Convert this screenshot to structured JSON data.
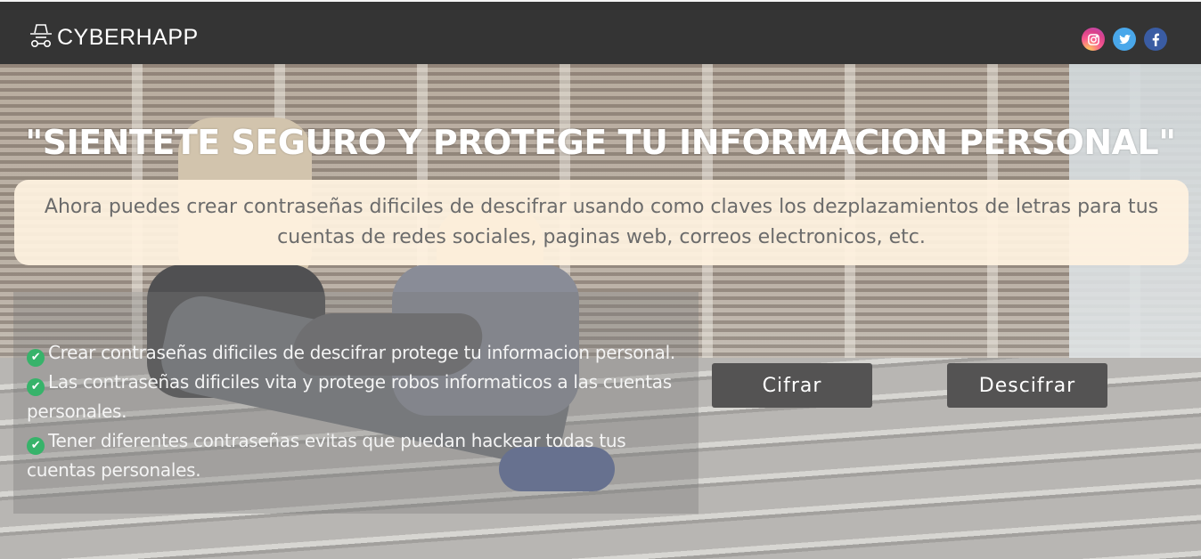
{
  "navbar": {
    "brand": "CYBERHAPP",
    "brand_icon": "hacker-incognito-icon",
    "social": [
      {
        "name": "instagram-icon",
        "glyph": "◎",
        "color": "#e4407f"
      },
      {
        "name": "twitter-icon",
        "glyph": "✦",
        "color": "#49a7ea"
      },
      {
        "name": "facebook-icon",
        "glyph": "f",
        "color": "#3a5ca3"
      }
    ]
  },
  "hero": {
    "headline": "\"SIENTETE SEGURO Y PROTEGE TU INFORMACION PERSONAL\"",
    "intro": "Ahora puedes crear contraseñas dificiles de descifrar usando como claves los dezplazamientos de letras para tus cuentas de redes sociales, paginas web, correos electronicos, etc."
  },
  "features": [
    {
      "icon": "check-circle-icon",
      "text": "Crear contraseñas dificiles de descifrar protege tu informacion personal."
    },
    {
      "icon": "check-circle-icon",
      "text": "Las contraseñas dificiles vita y protege robos informaticos a las cuentas personales."
    },
    {
      "icon": "check-circle-icon",
      "text": "Tener diferentes contraseñas evitas que puedan hackear todas tus cuentas personales."
    }
  ],
  "buttons": {
    "cifrar": "Cifrar",
    "descifrar": "Descifrar"
  },
  "colors": {
    "navbar_bg": "#343434",
    "button_bg": "#545353",
    "intro_bg": "#fff2e0",
    "check": "#37b36a"
  }
}
